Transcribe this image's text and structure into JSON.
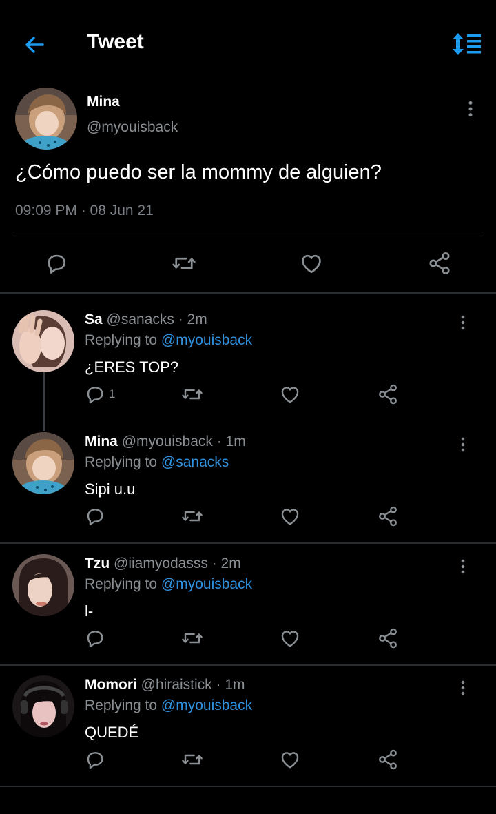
{
  "header": {
    "title": "Tweet",
    "back_icon": "arrow-left-icon",
    "sort_icon": "sort-icon",
    "accent": "#1d9bf0"
  },
  "main_tweet": {
    "name": "Mina",
    "handle": "@myouisback",
    "text": "¿Cómo puedo ser la mommy de alguien?",
    "timestamp": "09:09 PM · 08 Jun 21",
    "actions": [
      "reply-icon",
      "retweet-icon",
      "like-icon",
      "share-icon"
    ]
  },
  "replies": [
    {
      "name": "Sa",
      "meta": "@sanacks · 2m",
      "replying_label": "Replying to",
      "replying_to": "@myouisback",
      "text": "¿ERES TOP?",
      "reply_count": "1"
    },
    {
      "name": "Mina",
      "meta": "@myouisback · 1m",
      "replying_label": "Replying to",
      "replying_to": "@sanacks",
      "text": "Sipi u.u",
      "reply_count": ""
    },
    {
      "name": "Tzu",
      "meta": "@iiamyodasss · 2m",
      "replying_label": "Replying to",
      "replying_to": "@myouisback",
      "text": "l-",
      "reply_count": ""
    },
    {
      "name": "Momori",
      "meta": "@hiraistick · 1m",
      "replying_label": "Replying to",
      "replying_to": "@myouisback",
      "text": "QUEDÉ",
      "reply_count": ""
    }
  ],
  "colors": {
    "background": "#000000",
    "muted_text": "#8a8f94",
    "mention": "#2f90dd",
    "divider": "#2f3336"
  }
}
